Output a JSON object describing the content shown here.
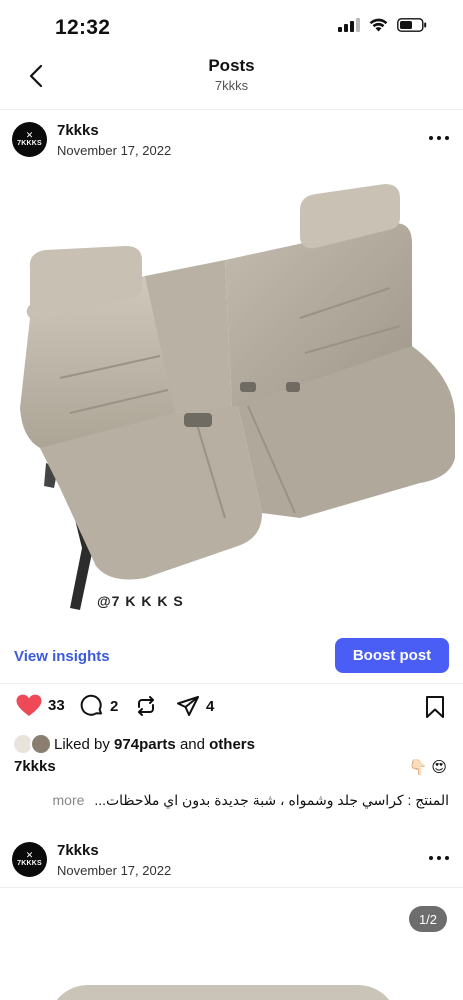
{
  "status": {
    "time": "12:32"
  },
  "header": {
    "title": "Posts",
    "subtitle": "7kkks"
  },
  "posts": [
    {
      "username": "7kkks",
      "date": "November 17, 2022",
      "avatar_text": "7KKKS",
      "watermark": "@7 K K K S",
      "counter": ""
    },
    {
      "username": "7kkks",
      "date": "November 17, 2022",
      "avatar_text": "7KKKS",
      "counter": "1/2"
    }
  ],
  "insights": {
    "view_label": "View insights",
    "boost_label": "Boost post"
  },
  "actions": {
    "likes": "33",
    "comments": "2",
    "shares": "4",
    "like_color": "#ed4956"
  },
  "liked_by": {
    "prefix": "Liked by",
    "user": "974parts",
    "and": "and",
    "others": "others"
  },
  "caption": {
    "username": "7kkks",
    "emojis": "👇🏻 😍",
    "text": "المنتج : كراسي جلد وشمواه ، شبة جديدة بدون اي ملاحظات...",
    "more": "more"
  },
  "colors": {
    "accent": "#4a5df5",
    "link": "#3b5bdb"
  },
  "icons": [
    "back-chevron-icon",
    "signal-icon",
    "wifi-icon",
    "battery-icon",
    "more-icon",
    "heart-icon",
    "comment-icon",
    "repost-icon",
    "send-icon",
    "bookmark-icon"
  ]
}
